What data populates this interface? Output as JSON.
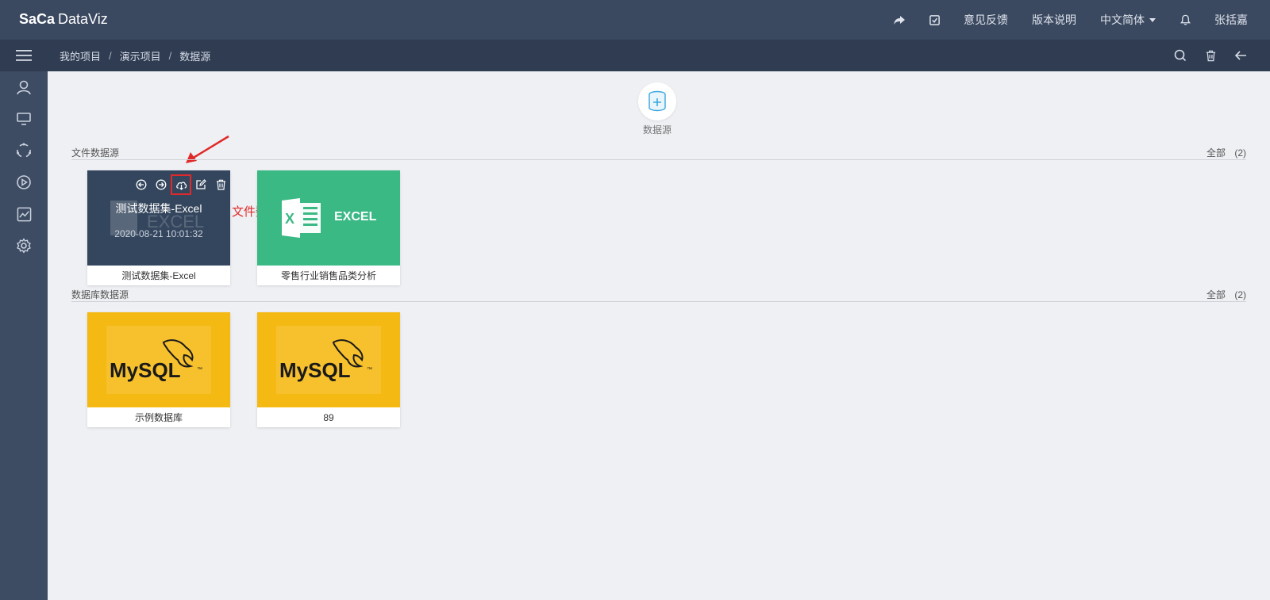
{
  "app": {
    "logo_mark": "SaCa",
    "logo_name": "DataViz"
  },
  "topbar": {
    "feedback": "意见反馈",
    "version": "版本说明",
    "language": "中文简体",
    "user": "张括嘉"
  },
  "breadcrumb": [
    "我的项目",
    "演示项目",
    "数据源"
  ],
  "breadcrumb_sep": "/",
  "add_datasource": {
    "label": "数据源"
  },
  "annotation": "文件数据源导出",
  "sections": [
    {
      "title": "文件数据源",
      "all_label": "全部",
      "count": "(2)",
      "items": [
        {
          "name": "测试数据集-Excel",
          "overlay_title": "测试数据集-Excel",
          "overlay_time": "2020-08-21 10:01:32",
          "type": "excel",
          "hovered": true
        },
        {
          "name": "零售行业销售品类分析",
          "type": "excel",
          "hovered": false,
          "thumb_label": "EXCEL"
        }
      ]
    },
    {
      "title": "数据库数据源",
      "all_label": "全部",
      "count": "(2)",
      "items": [
        {
          "name": "示例数据库",
          "type": "mysql"
        },
        {
          "name": "89",
          "type": "mysql"
        }
      ]
    }
  ],
  "colors": {
    "topbar": "#3a4860",
    "subbar": "#2f3c52",
    "sidebar": "#3d4b63",
    "excel": "#3bb985",
    "mysql": "#f5b914",
    "hover": "#34465d",
    "annotation": "#e02a2a"
  },
  "icons": {
    "top": [
      "share-icon",
      "edit-check-icon",
      "bell-icon"
    ],
    "sub": [
      "menu-icon",
      "search-icon",
      "trash-icon",
      "back-arrow-icon"
    ],
    "sidebar": [
      "user-icon",
      "monitor-icon",
      "cycle-icon",
      "play-icon",
      "chart-icon",
      "gear-icon"
    ],
    "card_tools": [
      "move-left-icon",
      "move-right-icon",
      "cloud-download-icon",
      "edit-icon",
      "delete-icon"
    ]
  }
}
